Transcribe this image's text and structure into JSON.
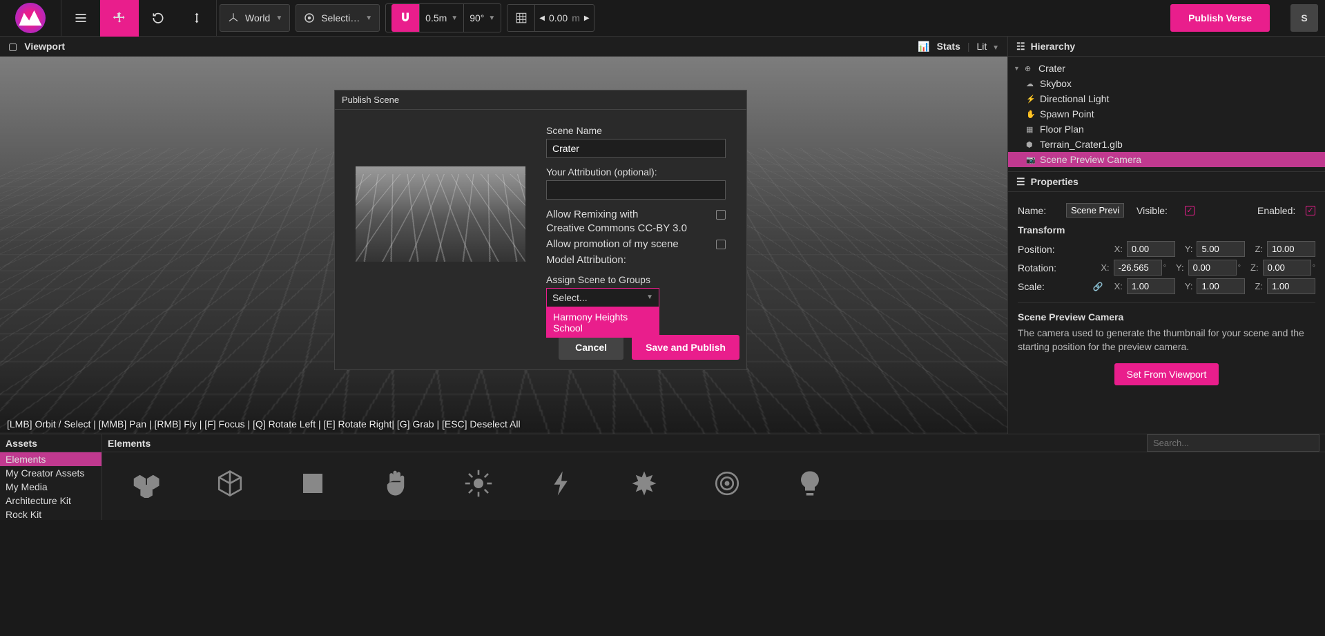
{
  "topbar": {
    "coordSpace": "World",
    "pivot": "Selecti…",
    "snapMove": "0.5m",
    "snapRotate": "90°",
    "gridValue": "0.00",
    "gridUnit": "m",
    "publish": "Publish Verse",
    "avatar": "S"
  },
  "viewport": {
    "title": "Viewport",
    "stats": "Stats",
    "renderMode": "Lit",
    "hints": "[LMB] Orbit / Select | [MMB] Pan | [RMB] Fly | [F] Focus | [Q] Rotate Left | [E] Rotate Right| [G] Grab | [ESC] Deselect All"
  },
  "hierarchy": {
    "title": "Hierarchy",
    "root": "Crater",
    "items": [
      {
        "label": "Skybox",
        "icon": "☁"
      },
      {
        "label": "Directional Light",
        "icon": "⚡"
      },
      {
        "label": "Spawn Point",
        "icon": "✋"
      },
      {
        "label": "Floor Plan",
        "icon": "▦"
      },
      {
        "label": "Terrain_Crater1.glb",
        "icon": "⬢"
      },
      {
        "label": "Scene Preview Camera",
        "icon": "📷",
        "selected": true
      }
    ]
  },
  "properties": {
    "title": "Properties",
    "nameLabel": "Name:",
    "nameValue": "Scene Preview",
    "visibleLabel": "Visible:",
    "enabledLabel": "Enabled:",
    "transformTitle": "Transform",
    "position": {
      "label": "Position:",
      "x": "0.00",
      "y": "5.00",
      "z": "10.00"
    },
    "rotation": {
      "label": "Rotation:",
      "x": "-26.565",
      "y": "0.00",
      "z": "0.00"
    },
    "scale": {
      "label": "Scale:",
      "x": "1.00",
      "y": "1.00",
      "z": "1.00"
    },
    "helpTitle": "Scene Preview Camera",
    "helpText": "The camera used to generate the thumbnail for your scene and the starting position for the preview camera.",
    "setViewport": "Set From Viewport"
  },
  "assets": {
    "tab": "Assets",
    "items": [
      "Elements",
      "My Creator Assets",
      "My Media",
      "Architecture Kit",
      "Rock Kit"
    ],
    "activeIndex": 0
  },
  "elements": {
    "title": "Elements",
    "searchPlaceholder": "Search..."
  },
  "modal": {
    "title": "Publish Scene",
    "sceneNameLabel": "Scene Name",
    "sceneName": "Crater",
    "attributionLabel": "Your Attribution (optional):",
    "attribution": "",
    "allowRemix1": "Allow Remixing  with",
    "allowRemix2": "Creative Commons  CC-BY 3.0",
    "allowPromo": "Allow promotion of my scene",
    "modelAttr": "Model Attribution:",
    "assignGroups": "Assign Scene to Groups",
    "selectPlaceholder": "Select...",
    "groupOption": "Harmony Heights School",
    "cancel": "Cancel",
    "save": "Save and Publish"
  }
}
